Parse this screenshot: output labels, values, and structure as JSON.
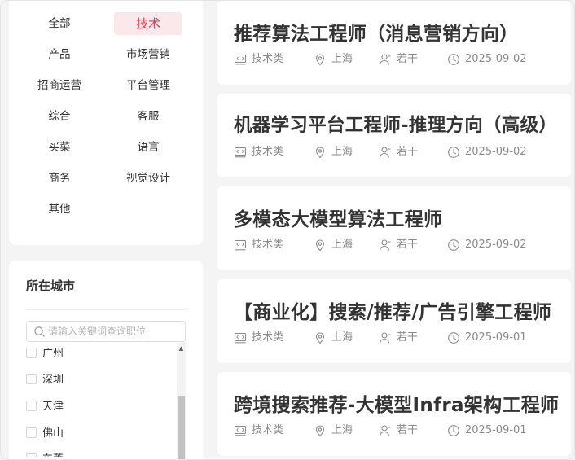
{
  "categories": [
    {
      "label": "全部",
      "active": false
    },
    {
      "label": "技术",
      "active": true
    },
    {
      "label": "产品",
      "active": false
    },
    {
      "label": "市场营销",
      "active": false
    },
    {
      "label": "招商运营",
      "active": false
    },
    {
      "label": "平台管理",
      "active": false
    },
    {
      "label": "综合",
      "active": false
    },
    {
      "label": "客服",
      "active": false
    },
    {
      "label": "买菜",
      "active": false
    },
    {
      "label": "语言",
      "active": false
    },
    {
      "label": "商务",
      "active": false
    },
    {
      "label": "视觉设计",
      "active": false
    },
    {
      "label": "其他",
      "active": false
    }
  ],
  "city_filter": {
    "title": "所在城市",
    "search_placeholder": "请输入关键词查询职位",
    "cities": [
      "广州",
      "深圳",
      "天津",
      "佛山",
      "东莞"
    ]
  },
  "jobs": [
    {
      "title": "推荐算法工程师（消息营销方向）",
      "category": "技术类",
      "location": "上海",
      "headcount": "若干",
      "date": "2025-09-02"
    },
    {
      "title": "机器学习平台工程师-推理方向（高级）",
      "category": "技术类",
      "location": "上海",
      "headcount": "若干",
      "date": "2025-09-02"
    },
    {
      "title": "多模态大模型算法工程师",
      "category": "技术类",
      "location": "上海",
      "headcount": "若干",
      "date": "2025-09-02"
    },
    {
      "title": "【商业化】搜索/推荐/广告引擎工程师",
      "category": "技术类",
      "location": "上海",
      "headcount": "若干",
      "date": "2025-09-01"
    },
    {
      "title": "跨境搜索推荐-大模型Infra架构工程师",
      "category": "技术类",
      "location": "上海",
      "headcount": "若干",
      "date": "2025-09-01"
    }
  ],
  "colors": {
    "accent": "#e8384f",
    "accent_bg": "#fbe8ea",
    "page_bg": "#f4f4f5"
  },
  "icons": {
    "category": "code-window-icon",
    "location": "location-pin-icon",
    "headcount": "person-icon",
    "date": "clock-icon",
    "search": "search-icon"
  }
}
